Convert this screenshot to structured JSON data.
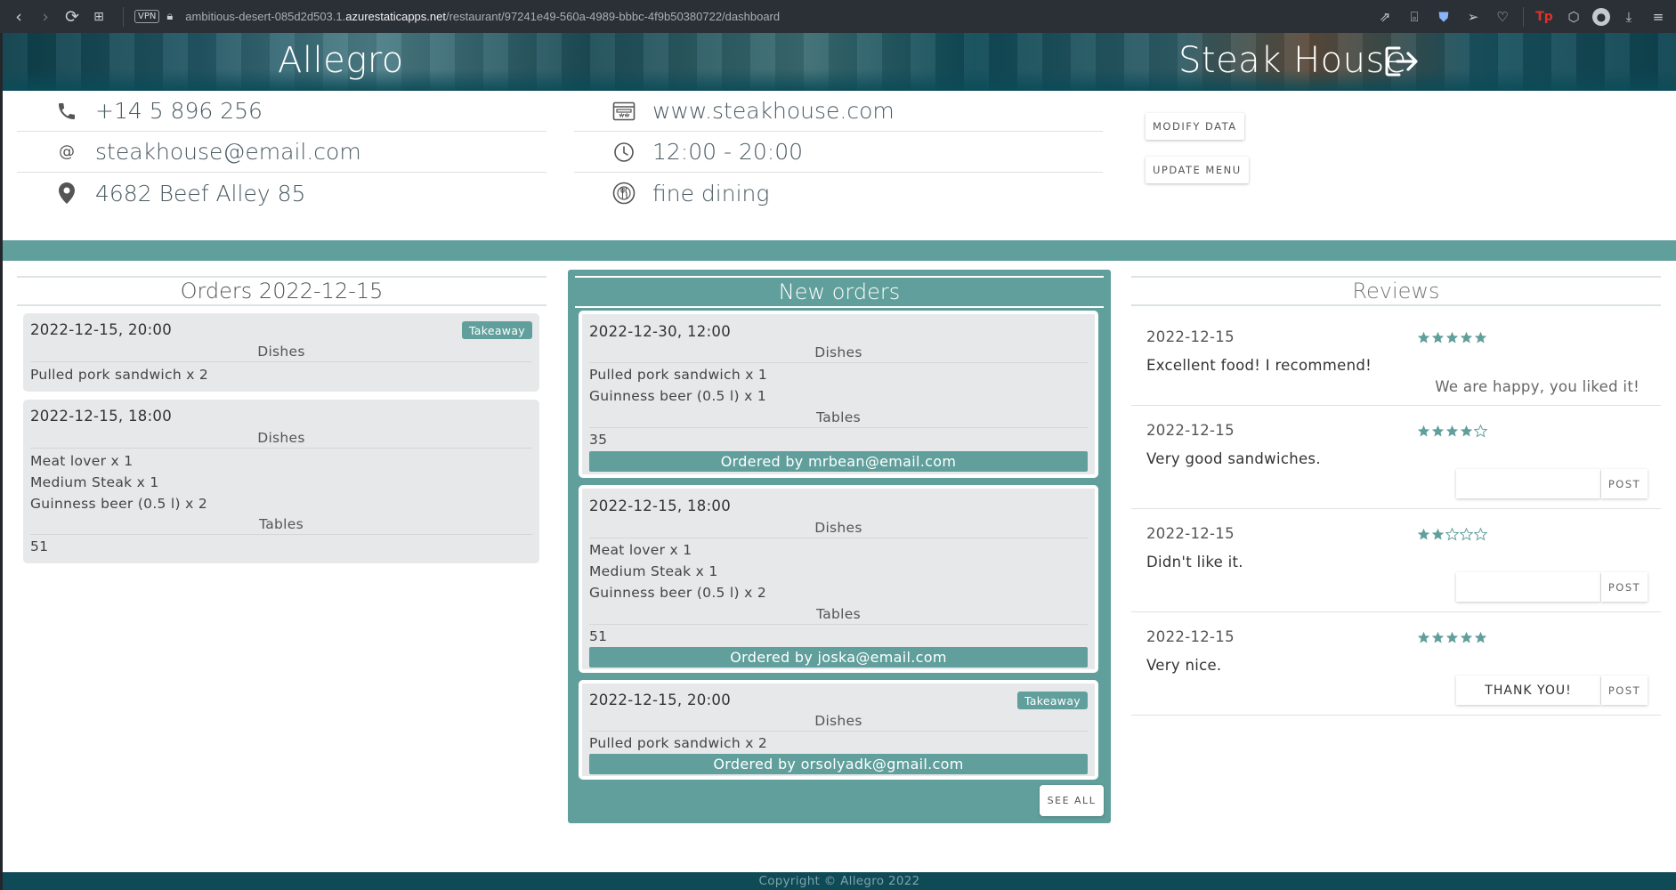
{
  "browser": {
    "vpn_label": "VPN",
    "url_prefix": "ambitious-desert-085d2d503.1.",
    "url_host": "azurestaticapps.net",
    "url_path": "/restaurant/97241e49-560a-4989-bbbc-4f9b50380722/dashboard"
  },
  "header": {
    "brand": "Allegro",
    "restaurant_name": "Steak House"
  },
  "info": {
    "phone": "+14 5 896 256",
    "email": "steakhouse@email.com",
    "address": "4682 Beef Alley 85",
    "website": "www.steakhouse.com",
    "hours": "12:00 - 20:00",
    "category": "fine dining"
  },
  "actions": {
    "modify_label": "MODIFY DATA",
    "update_label": "UPDATE MENU"
  },
  "orders_today": {
    "title": "Orders 2022-12-15",
    "orders": [
      {
        "datetime": "2022-12-15, 20:00",
        "badge": "Takeaway",
        "dishes_label": "Dishes",
        "dishes": [
          "Pulled pork sandwich x 2"
        ]
      },
      {
        "datetime": "2022-12-15, 18:00",
        "dishes_label": "Dishes",
        "dishes": [
          "Meat lover x 1",
          "Medium Steak x 1",
          "Guinness beer (0.5 l) x 2"
        ],
        "tables_label": "Tables",
        "tables": "51"
      }
    ]
  },
  "new_orders": {
    "title": "New orders",
    "see_all_label": "SEE ALL",
    "orders": [
      {
        "datetime": "2022-12-30, 12:00",
        "dishes_label": "Dishes",
        "dishes": [
          "Pulled pork sandwich x 1",
          "Guinness beer (0.5 l) x 1"
        ],
        "tables_label": "Tables",
        "tables": "35",
        "ordered_by": "Ordered by mrbean@email.com"
      },
      {
        "datetime": "2022-12-15, 18:00",
        "dishes_label": "Dishes",
        "dishes": [
          "Meat lover x 1",
          "Medium Steak x 1",
          "Guinness beer (0.5 l) x 2"
        ],
        "tables_label": "Tables",
        "tables": "51",
        "ordered_by": "Ordered by joska@email.com"
      },
      {
        "datetime": "2022-12-15, 20:00",
        "badge": "Takeaway",
        "dishes_label": "Dishes",
        "dishes": [
          "Pulled pork sandwich x 2"
        ],
        "ordered_by": "Ordered by orsolyadk@gmail.com"
      }
    ]
  },
  "reviews": {
    "title": "Reviews",
    "post_label": "POST",
    "items": [
      {
        "date": "2022-12-15",
        "rating": 5,
        "text": "Excellent food! I recommend!",
        "reply": "We are happy, you liked it!"
      },
      {
        "date": "2022-12-15",
        "rating": 4,
        "text": "Very good sandwiches.",
        "reply_input": ""
      },
      {
        "date": "2022-12-15",
        "rating": 2,
        "text": "Didn't like it.",
        "reply_input": ""
      },
      {
        "date": "2022-12-15",
        "rating": 5,
        "text": "Very nice.",
        "reply_input": "THANK YOU!"
      }
    ]
  },
  "footer": {
    "copyright": "Copyright © Allegro 2022"
  },
  "colors": {
    "accent_teal": "#609f9b",
    "header_dark": "#0f4a57",
    "star": "#609f9b"
  }
}
